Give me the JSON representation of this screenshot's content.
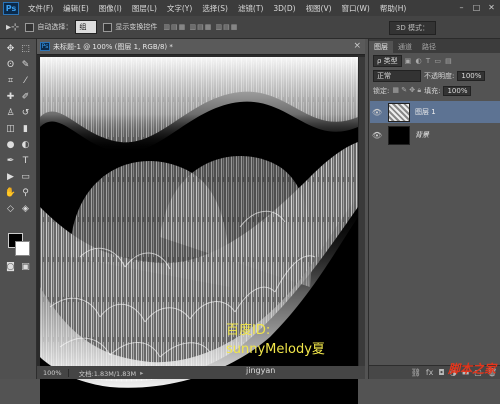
{
  "menubar": {
    "logo": "Ps",
    "items": [
      "文件(F)",
      "编辑(E)",
      "图像(I)",
      "图层(L)",
      "文字(Y)",
      "选择(S)",
      "滤镜(T)",
      "3D(D)",
      "视图(V)",
      "窗口(W)",
      "帮助(H)"
    ]
  },
  "options": {
    "auto_select_label": "自动选择：",
    "auto_select_value": "组",
    "show_transform_label": "显示变换控件",
    "mode_3d": "3D 模式："
  },
  "document": {
    "tab_title": "未标题-1 @ 100% (图层 1, RGB/8) *",
    "zoom": "100%",
    "doc_info": "文档:1.83M/1.83M",
    "watermark_line1": "百度ID:",
    "watermark_line2": "sunnyMelody夏"
  },
  "panels": {
    "tabs": [
      "图层",
      "通道",
      "路径"
    ],
    "kind_label": "ρ 类型",
    "blend_mode": "正常",
    "opacity_label": "不透明度:",
    "opacity_value": "100%",
    "lock_label": "锁定:",
    "fill_label": "填充:",
    "fill_value": "100%",
    "layers": [
      {
        "name": "图层 1"
      },
      {
        "name": "背景"
      }
    ]
  },
  "site_watermark": "脚本之家",
  "site_watermark2": "jingyan",
  "colors": {
    "accent_blue": "#3ba0f0",
    "watermark_yellow": "#f1e64a",
    "layer_selected": "#5d7393"
  }
}
